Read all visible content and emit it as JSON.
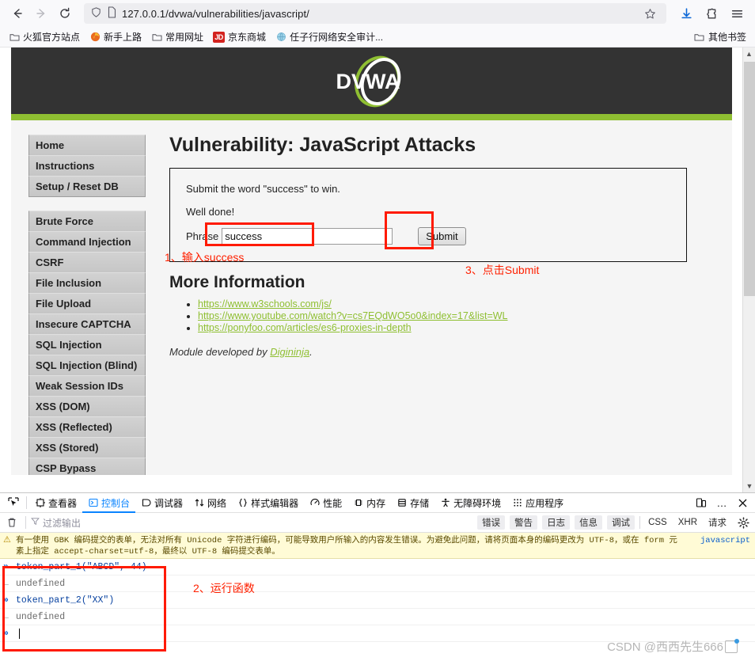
{
  "browser": {
    "back_icon": "back-arrow",
    "forward_icon": "forward-arrow",
    "reload_icon": "reload",
    "url": "127.0.0.1/dvwa/vulnerabilities/javascript/",
    "bookmark_star": "star-icon",
    "download_icon": "download",
    "extension_icon": "puzzle",
    "menu_icon": "hamburger",
    "bookmarks": [
      {
        "label": "火狐官方站点",
        "icon": "folder-icon"
      },
      {
        "label": "新手上路",
        "icon": "firefox-icon"
      },
      {
        "label": "常用网址",
        "icon": "folder-icon"
      },
      {
        "label": "京东商城",
        "icon": "jd-icon"
      },
      {
        "label": "任子行网络安全审计...",
        "icon": "globe-icon"
      }
    ],
    "other_bookmarks": "其他书签"
  },
  "dvwa": {
    "logo_text": "DVWA",
    "nav_group_1": [
      {
        "label": "Home"
      },
      {
        "label": "Instructions"
      },
      {
        "label": "Setup / Reset DB"
      }
    ],
    "nav_group_2": [
      {
        "label": "Brute Force"
      },
      {
        "label": "Command Injection"
      },
      {
        "label": "CSRF"
      },
      {
        "label": "File Inclusion"
      },
      {
        "label": "File Upload"
      },
      {
        "label": "Insecure CAPTCHA"
      },
      {
        "label": "SQL Injection"
      },
      {
        "label": "SQL Injection (Blind)"
      },
      {
        "label": "Weak Session IDs"
      },
      {
        "label": "XSS (DOM)"
      },
      {
        "label": "XSS (Reflected)"
      },
      {
        "label": "XSS (Stored)"
      },
      {
        "label": "CSP Bypass"
      }
    ],
    "page_title": "Vulnerability: JavaScript Attacks",
    "instruction": "Submit the word \"success\" to win.",
    "result_message": "Well done!",
    "phrase_label": "Phrase",
    "phrase_value": "success",
    "submit_label": "Submit",
    "more_info_title": "More Information",
    "links": [
      "https://www.w3schools.com/js/",
      "https://www.youtube.com/watch?v=cs7EQdWO5o0&index=17&list=WL",
      "https://ponyfoo.com/articles/es6-proxies-in-depth"
    ],
    "module_note_prefix": "Module developed by ",
    "module_note_link": "Digininja",
    "module_note_suffix": "."
  },
  "annotations": {
    "step1": "1、输入success",
    "step2": "2、运行函数",
    "step3": "3、点击Submit"
  },
  "devtools": {
    "picker_icon": "element-picker-icon",
    "tabs": [
      {
        "label": "查看器",
        "icon": "inspector-icon",
        "active": false
      },
      {
        "label": "控制台",
        "icon": "console-icon",
        "active": true
      },
      {
        "label": "调试器",
        "icon": "debugger-icon",
        "active": false
      },
      {
        "label": "网络",
        "icon": "network-icon",
        "active": false
      },
      {
        "label": "样式编辑器",
        "icon": "style-editor-icon",
        "active": false
      },
      {
        "label": "性能",
        "icon": "performance-icon",
        "active": false
      },
      {
        "label": "内存",
        "icon": "memory-icon",
        "active": false
      },
      {
        "label": "存储",
        "icon": "storage-icon",
        "active": false
      },
      {
        "label": "无障碍环境",
        "icon": "accessibility-icon",
        "active": false
      },
      {
        "label": "应用程序",
        "icon": "application-icon",
        "active": false
      }
    ],
    "responsive_icon": "responsive-design-mode-icon",
    "more_icon": "meatball-menu-icon",
    "close_icon": "close-icon",
    "trash_icon": "trash-icon",
    "filter_placeholder": "过滤输出",
    "filter_icon": "funnel-icon",
    "level_buttons": [
      "错误",
      "警告",
      "日志",
      "信息",
      "调试"
    ],
    "type_buttons": [
      "CSS",
      "XHR",
      "请求"
    ],
    "settings_icon": "gear-icon",
    "warning": {
      "icon": "warning-triangle-icon",
      "line1": "有一使用 GBK 编码提交的表单，无法对所有 Unicode 字符进行编码，可能导致用户所输入的内容发生错误。为避免此问题，请将页面本身的编码更改为 UTF-8，或在 form 元",
      "line2": "素上指定 accept-charset=utf-8，最终以 UTF-8 编码提交表单。",
      "source": "javascript"
    },
    "console_entries": [
      {
        "kind": "input",
        "text": "token_part_1(\"ABCD\", 44)"
      },
      {
        "kind": "output",
        "text": "undefined"
      },
      {
        "kind": "input",
        "text": "token_part_2(\"XX\")"
      },
      {
        "kind": "output",
        "text": "undefined"
      }
    ],
    "prompt_arrow": "»"
  },
  "watermark": {
    "text": "CSDN @西西先生666"
  },
  "colors": {
    "accent_green": "#8fbf32",
    "dark_header": "#333333",
    "annotation_red": "#ff2000",
    "active_tab_blue": "#0a84ff"
  }
}
